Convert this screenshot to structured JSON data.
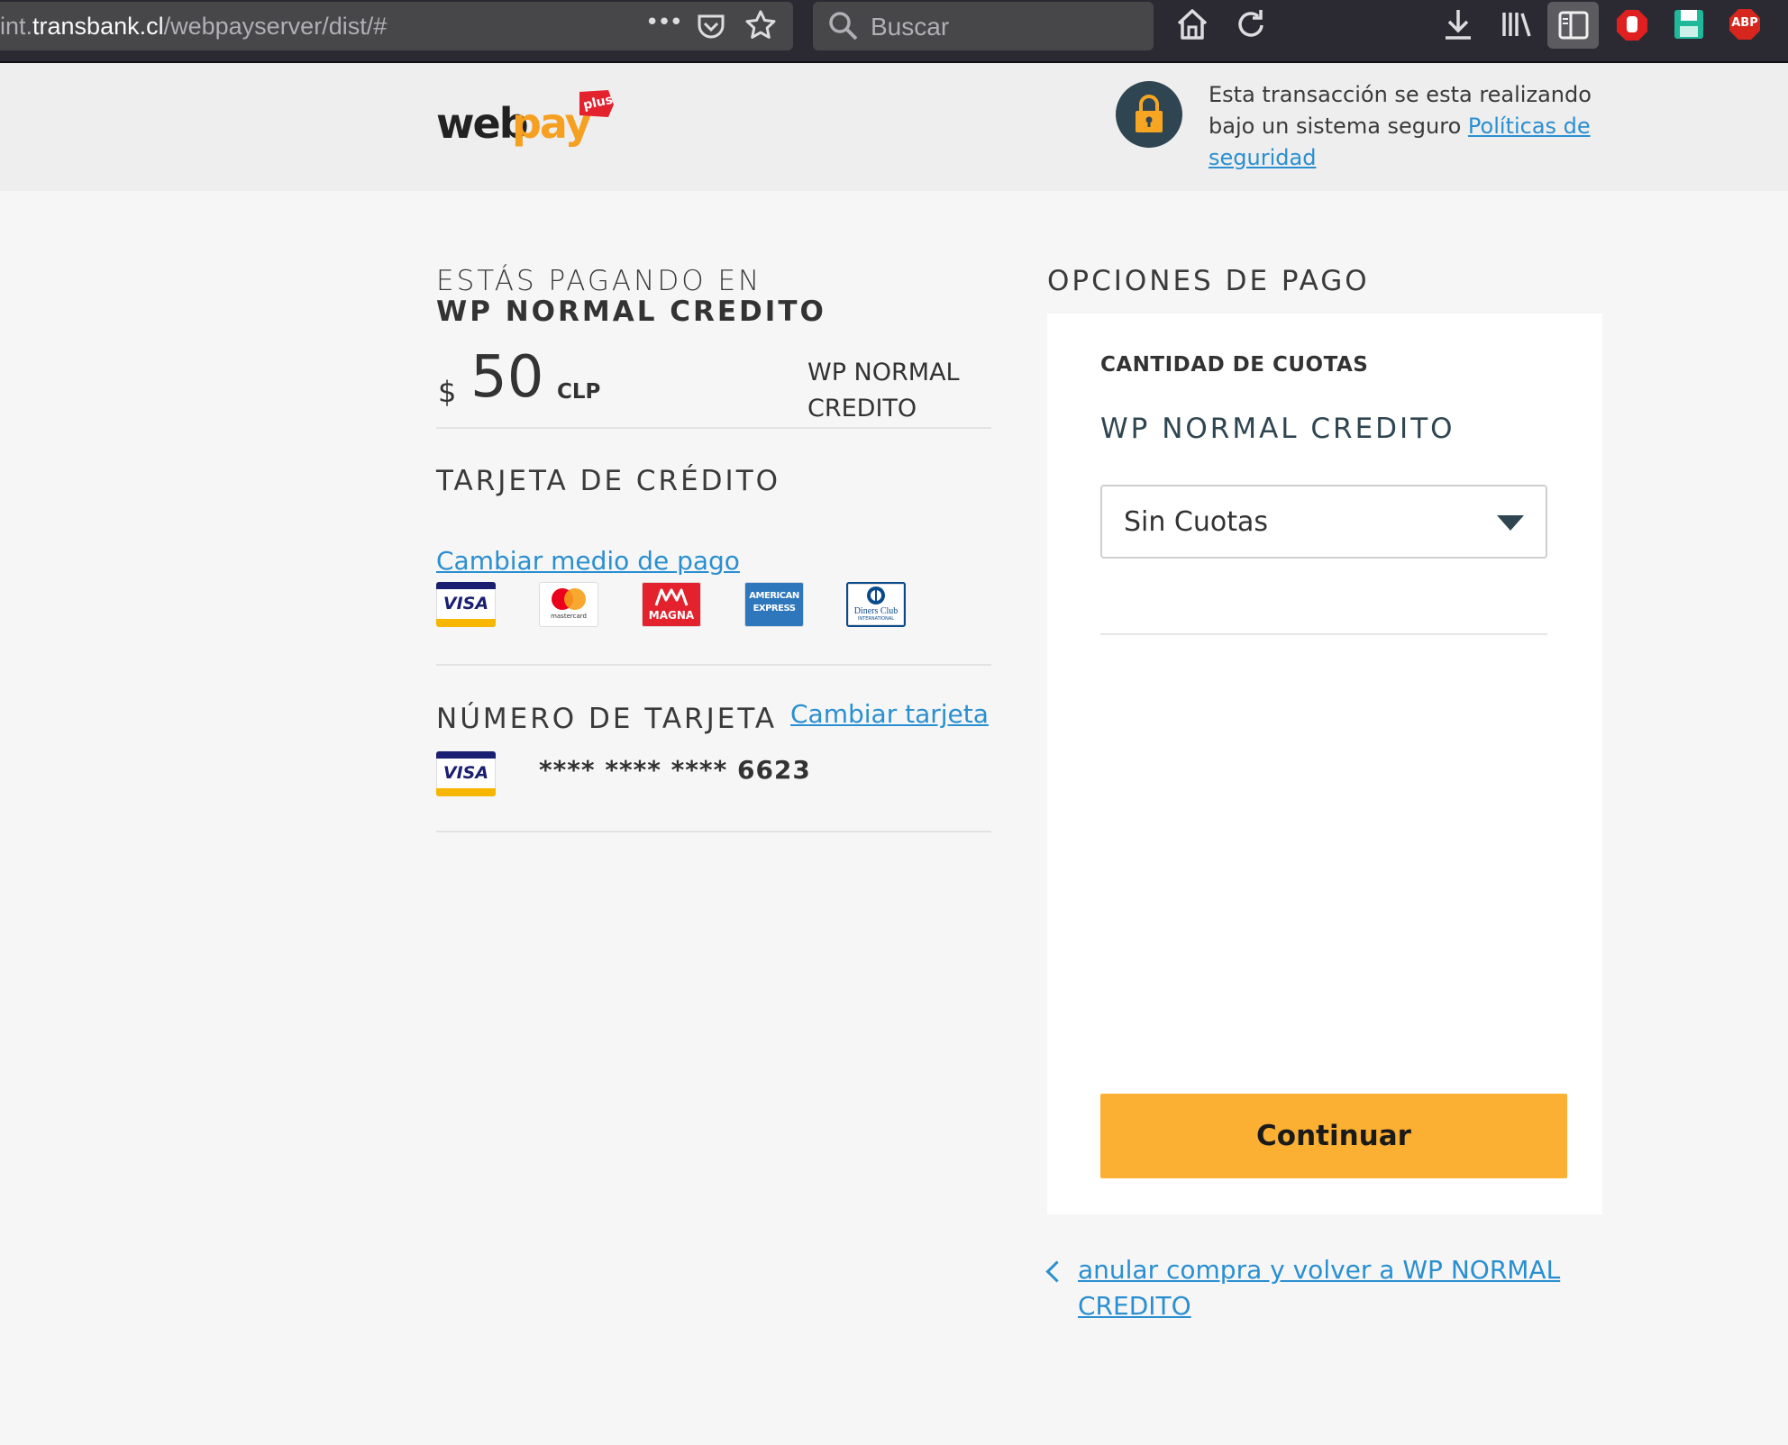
{
  "browser": {
    "url_prefix": "int.",
    "url_host": "transbank.cl",
    "url_path": "/webpayserver/dist/#",
    "menu_dots": "•••",
    "search_placeholder": "Buscar",
    "abp_label": "ABP"
  },
  "header": {
    "logo_text_1": "web",
    "logo_text_2": "pay",
    "logo_plus": "plus",
    "secure_text": "Esta transacción se esta realizando bajo un sistema seguro ",
    "security_link": "Políticas de seguridad"
  },
  "payment": {
    "paying_label": "ESTÁS PAGANDO EN",
    "merchant": "WP NORMAL CREDITO",
    "currency_symbol": "$",
    "amount": "50",
    "currency": "CLP",
    "amount_merchant": "WP NORMAL CREDITO"
  },
  "card_section": {
    "title": "TARJETA DE CRÉDITO",
    "change_method_link": "Cambiar medio de pago",
    "brands": {
      "visa": "VISA",
      "mastercard": "mastercard",
      "magna": "MAGNA",
      "amex_1": "AMERICAN",
      "amex_2": "EXPRESS",
      "diners_1": "Diners Club",
      "diners_2": "INTERNATIONAL"
    }
  },
  "card_number_section": {
    "title": "NÚMERO DE TARJETA",
    "change_card_link": "Cambiar tarjeta",
    "card_brand": "VISA",
    "masked_number": "**** **** **** 6623"
  },
  "options": {
    "title": "OPCIONES DE PAGO",
    "installments_label": "CANTIDAD DE CUOTAS",
    "merchant": "WP NORMAL CREDITO",
    "installments_selected": "Sin Cuotas",
    "continue_button": "Continuar",
    "cancel_link": "anular compra y volver a WP NORMAL CREDITO"
  },
  "colors": {
    "accent_button": "#fbb033",
    "link": "#2a8fd1",
    "dark_teal": "#2f4551"
  }
}
